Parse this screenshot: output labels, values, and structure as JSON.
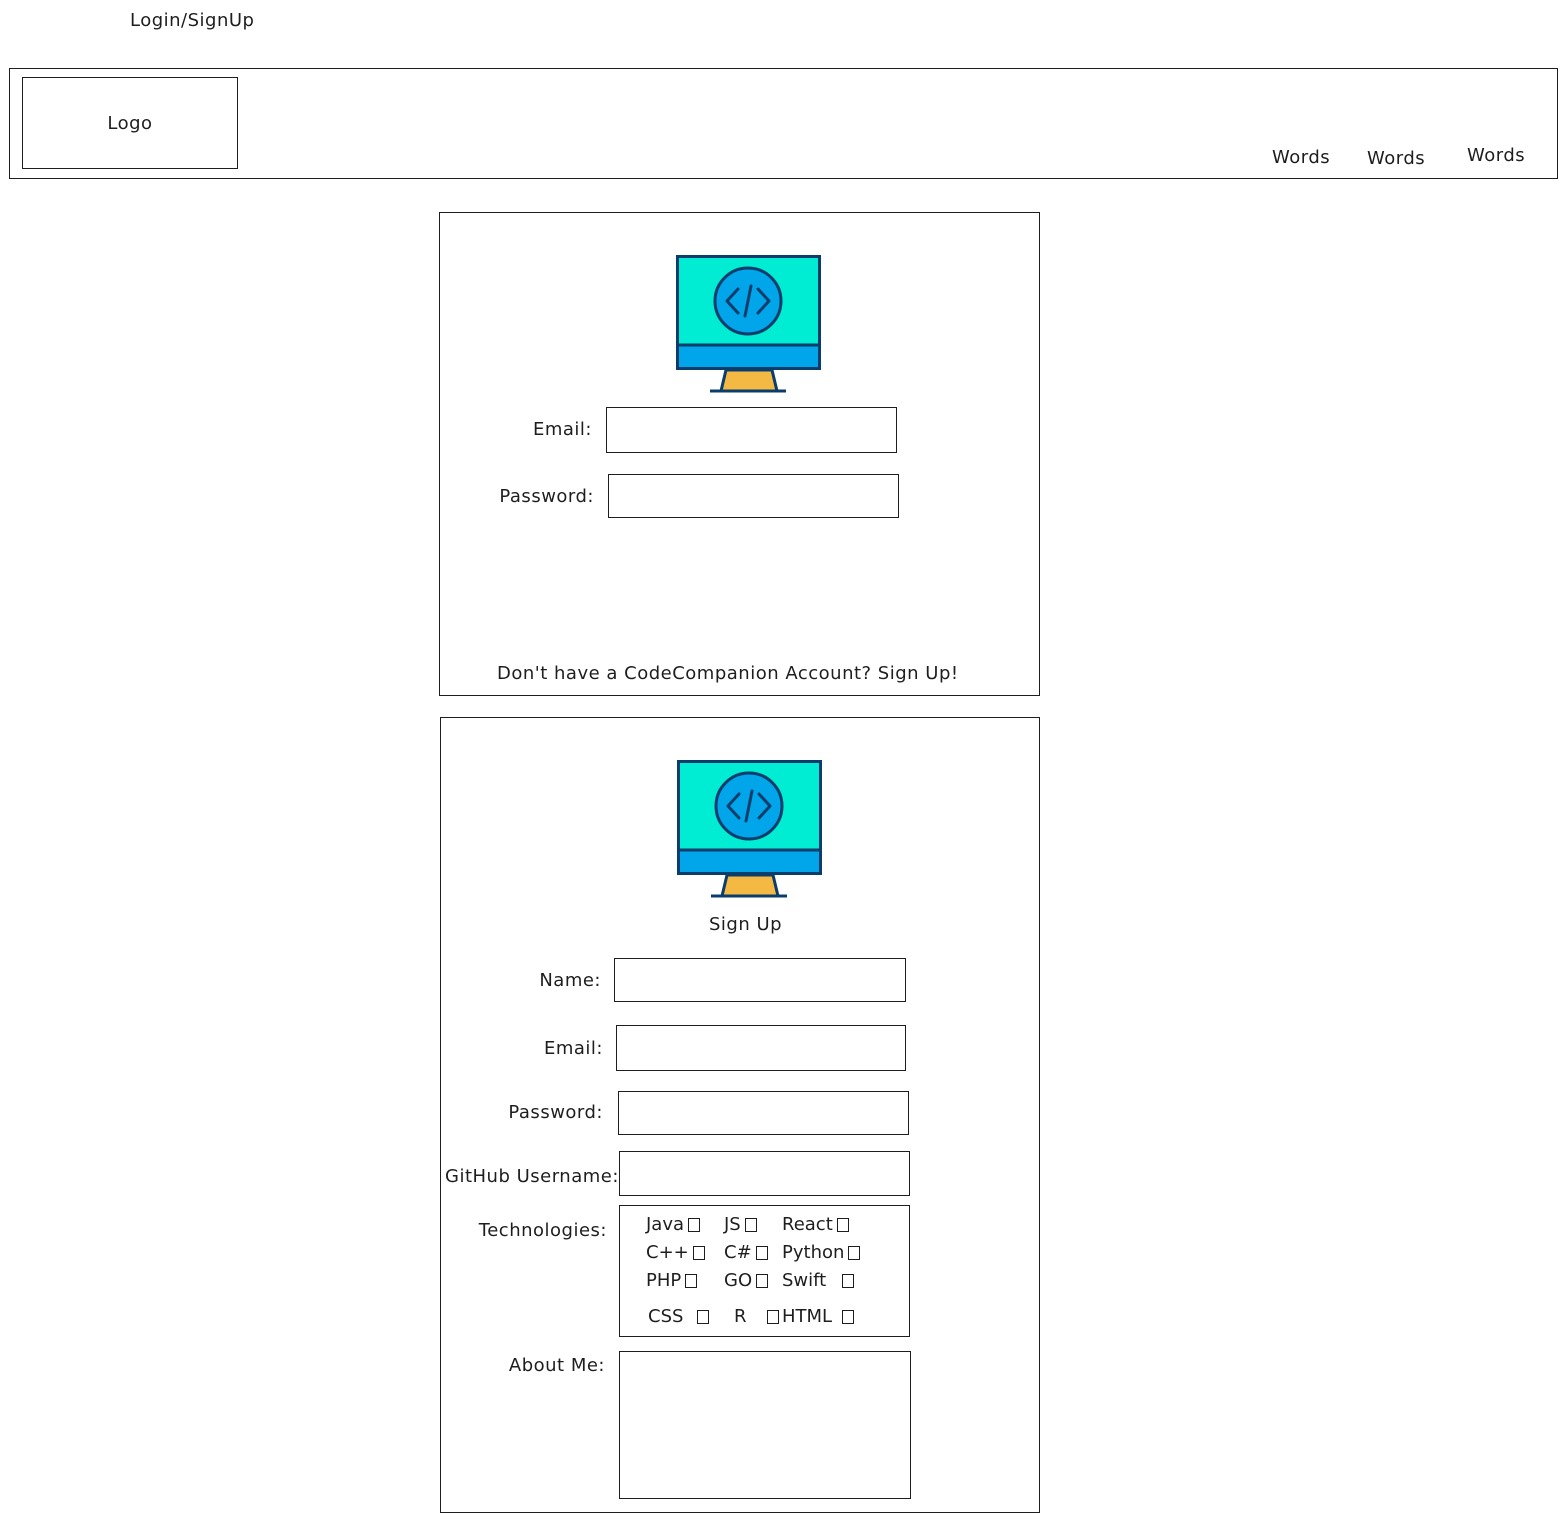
{
  "page": {
    "title": "Login/SignUp"
  },
  "header": {
    "logo_label": "Logo",
    "nav_items": [
      "Words",
      "Words",
      "Words"
    ]
  },
  "login": {
    "icon": "code-monitor-icon",
    "fields": [
      {
        "label": "Email:",
        "value": "",
        "placeholder": ""
      },
      {
        "label": "Password:",
        "value": "",
        "placeholder": ""
      }
    ],
    "signup_link": "Don't have a CodeCompanion Account? Sign Up!"
  },
  "signup": {
    "icon": "code-monitor-icon",
    "title": "Sign Up",
    "fields": [
      {
        "label": "Name:",
        "value": "",
        "placeholder": ""
      },
      {
        "label": "Email:",
        "value": "",
        "placeholder": ""
      },
      {
        "label": "Password:",
        "value": "",
        "placeholder": ""
      },
      {
        "label": "GitHub Username:",
        "value": "",
        "placeholder": ""
      }
    ],
    "technologies_label": "Technologies:",
    "technologies": [
      [
        "Java",
        "JS",
        "React"
      ],
      [
        "C++",
        "C#",
        "Python"
      ],
      [
        "PHP",
        "GO",
        "Swift"
      ],
      [
        "CSS",
        "R",
        "HTML"
      ]
    ],
    "about_label": "About Me:",
    "about_value": ""
  },
  "colors": {
    "screen": "#00edd3",
    "screen_bar": "#00a5ea",
    "outline": "#0a3d6b",
    "stand": "#f4b942",
    "stroke": "#1e1e1e"
  }
}
